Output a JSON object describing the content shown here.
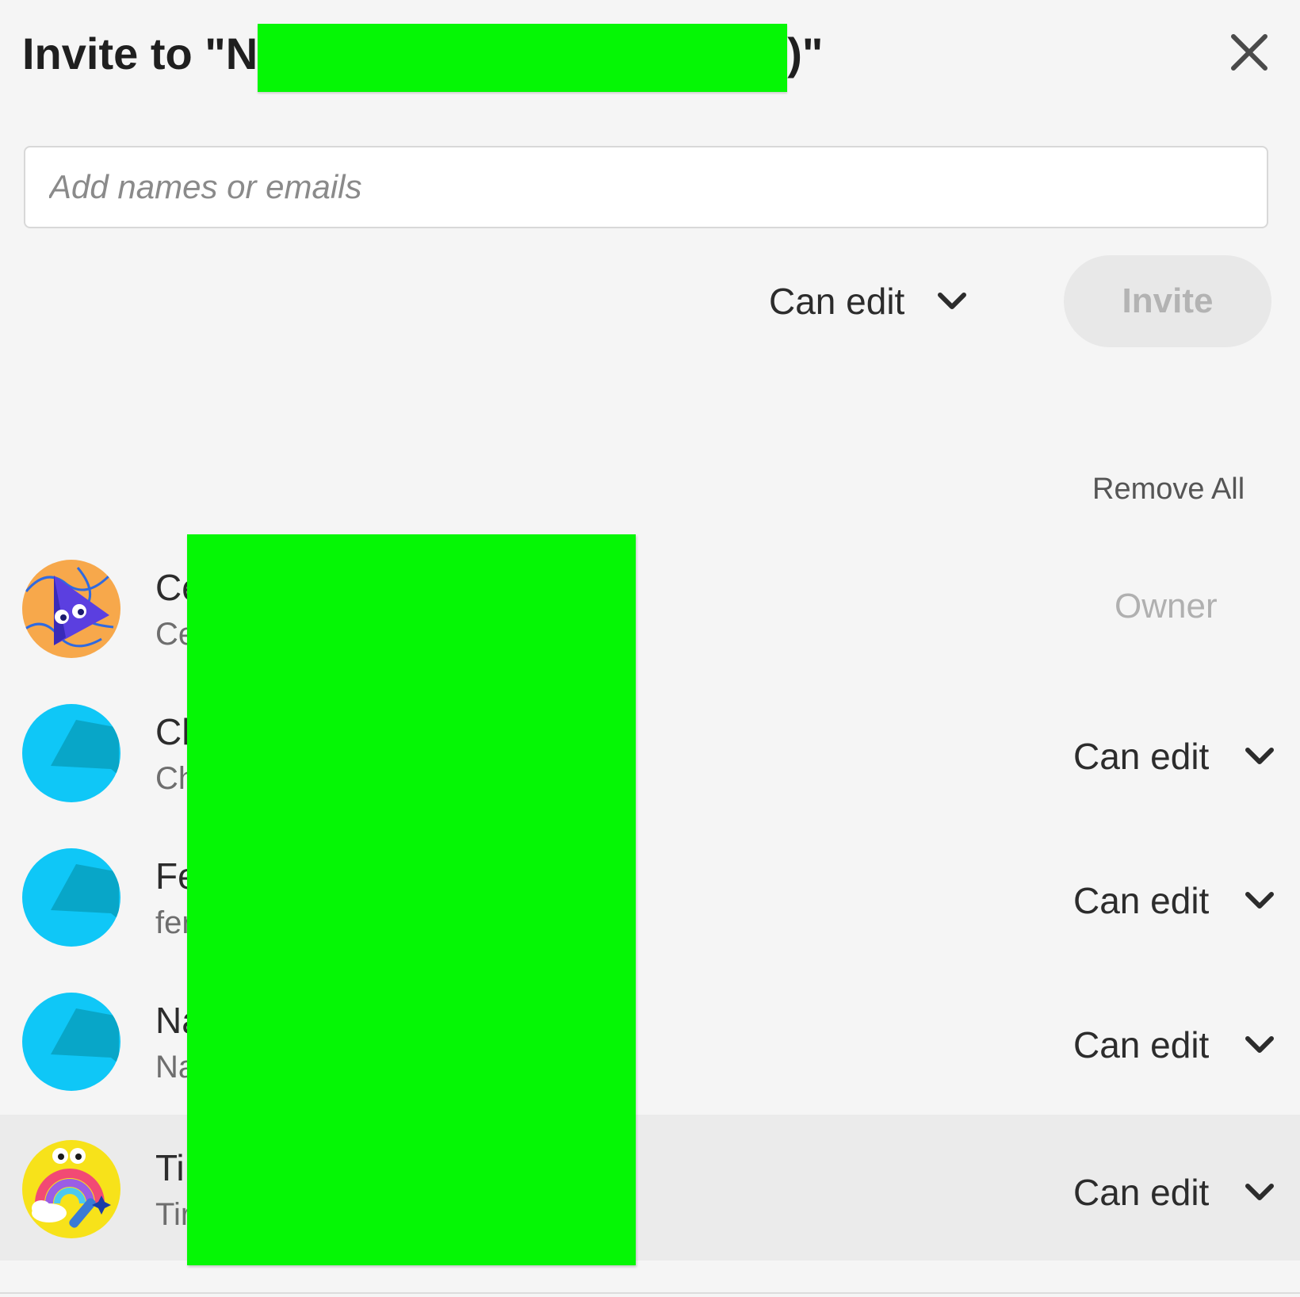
{
  "dialog": {
    "title_prefix": "Invite to \"N",
    "title_suffix": ")\""
  },
  "input": {
    "placeholder": "Add names or emails",
    "value": ""
  },
  "invite_permission": {
    "selected": "Can edit"
  },
  "invite_button": {
    "label": "Invite"
  },
  "remove_all": {
    "label": "Remove All"
  },
  "members": [
    {
      "name": "Ce",
      "email": "Ce",
      "role": "Owner",
      "avatar": "cursor-character-avatar"
    },
    {
      "name": "Ch",
      "email": "Ch",
      "role": "Can edit",
      "avatar": "default-avatar"
    },
    {
      "name": "Fe",
      "email": "fer",
      "role": "Can edit",
      "avatar": "default-avatar"
    },
    {
      "name": "Na",
      "email": "Na",
      "role": "Can edit",
      "avatar": "default-avatar"
    },
    {
      "name": "Ti",
      "email": "Tir",
      "role": "Can edit",
      "avatar": "rainbow-character-avatar"
    }
  ],
  "colors": {
    "background": "#f5f5f5",
    "redaction": "#05f705",
    "default_avatar": "#0fc7f7",
    "highlight_row": "#ebebeb"
  }
}
